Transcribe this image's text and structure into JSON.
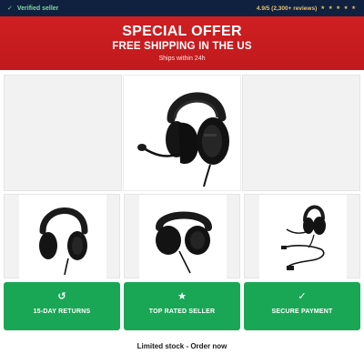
{
  "topbar": {
    "verified_icon": "check-icon",
    "verified_label": "Verified seller",
    "rating_text": "4.9/5 (2,300+ reviews)",
    "stars": "★ ★ ★ ★ ★",
    "accent_color": "#7fd8a0",
    "rating_color": "#e8c36a"
  },
  "banner": {
    "title": "SPECIAL OFFER",
    "subtitle": "FREE SHIPPING IN THE US",
    "note": "Ships within 24h",
    "color": "#cc1e21"
  },
  "gallery": {
    "main_image": "headset-front-view",
    "thumbnails": [
      "headset-angled-view",
      "headset-folded-view",
      "headset-with-cable-view"
    ]
  },
  "badges": [
    {
      "icon": "↺",
      "icon_name": "refresh-icon",
      "label": "15-DAY RETURNS"
    },
    {
      "icon": "★",
      "icon_name": "star-icon",
      "label": "TOP RATED SELLER"
    },
    {
      "icon": "✓",
      "icon_name": "check-icon",
      "label": "SECURE PAYMENT"
    }
  ],
  "badge_color": "#1aa755",
  "footer": {
    "text": "Limited stock - Order now"
  }
}
